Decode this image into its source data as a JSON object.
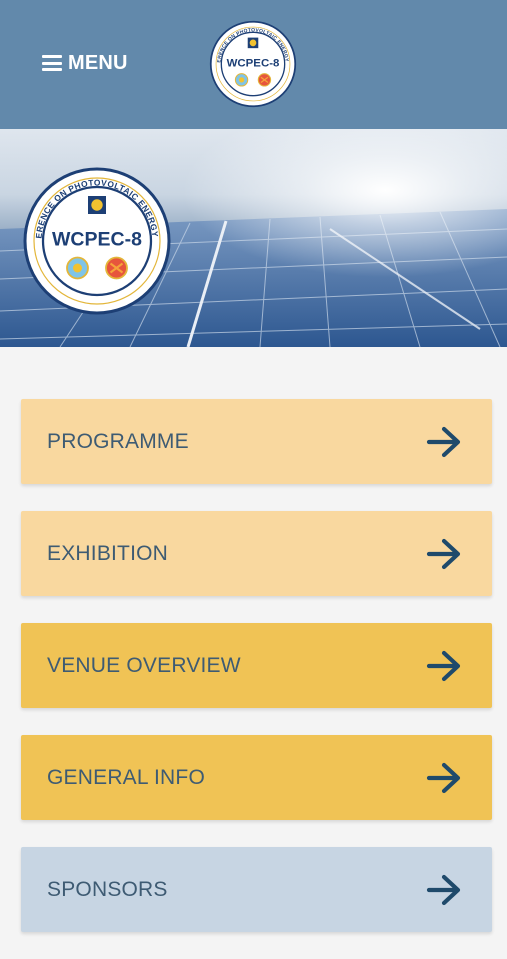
{
  "header": {
    "menu_label": "MENU",
    "logo_text": "WCPEC-8",
    "logo_ring_text": "WORLD CONFERENCE ON PHOTOVOLTAIC ENERGY CONVERSION"
  },
  "hero": {
    "logo_text": "WCPEC-8",
    "logo_ring_text": "WORLD CONFERENCE ON PHOTOVOLTAIC ENERGY CONVERSION"
  },
  "nav": {
    "items": [
      {
        "label": "PROGRAMME",
        "color": "#f9d89f"
      },
      {
        "label": "EXHIBITION",
        "color": "#f9d89f"
      },
      {
        "label": "VENUE OVERVIEW",
        "color": "#f0c355"
      },
      {
        "label": "GENERAL INFO",
        "color": "#f0c355"
      },
      {
        "label": "SPONSORS",
        "color": "#c7d5e3"
      }
    ]
  },
  "colors": {
    "header_bg": "#6289ab",
    "label_text": "#3e5b73",
    "arrow": "#1f4a6b"
  },
  "icons": {
    "menu": "hamburger-icon",
    "arrow": "arrow-right-icon"
  }
}
